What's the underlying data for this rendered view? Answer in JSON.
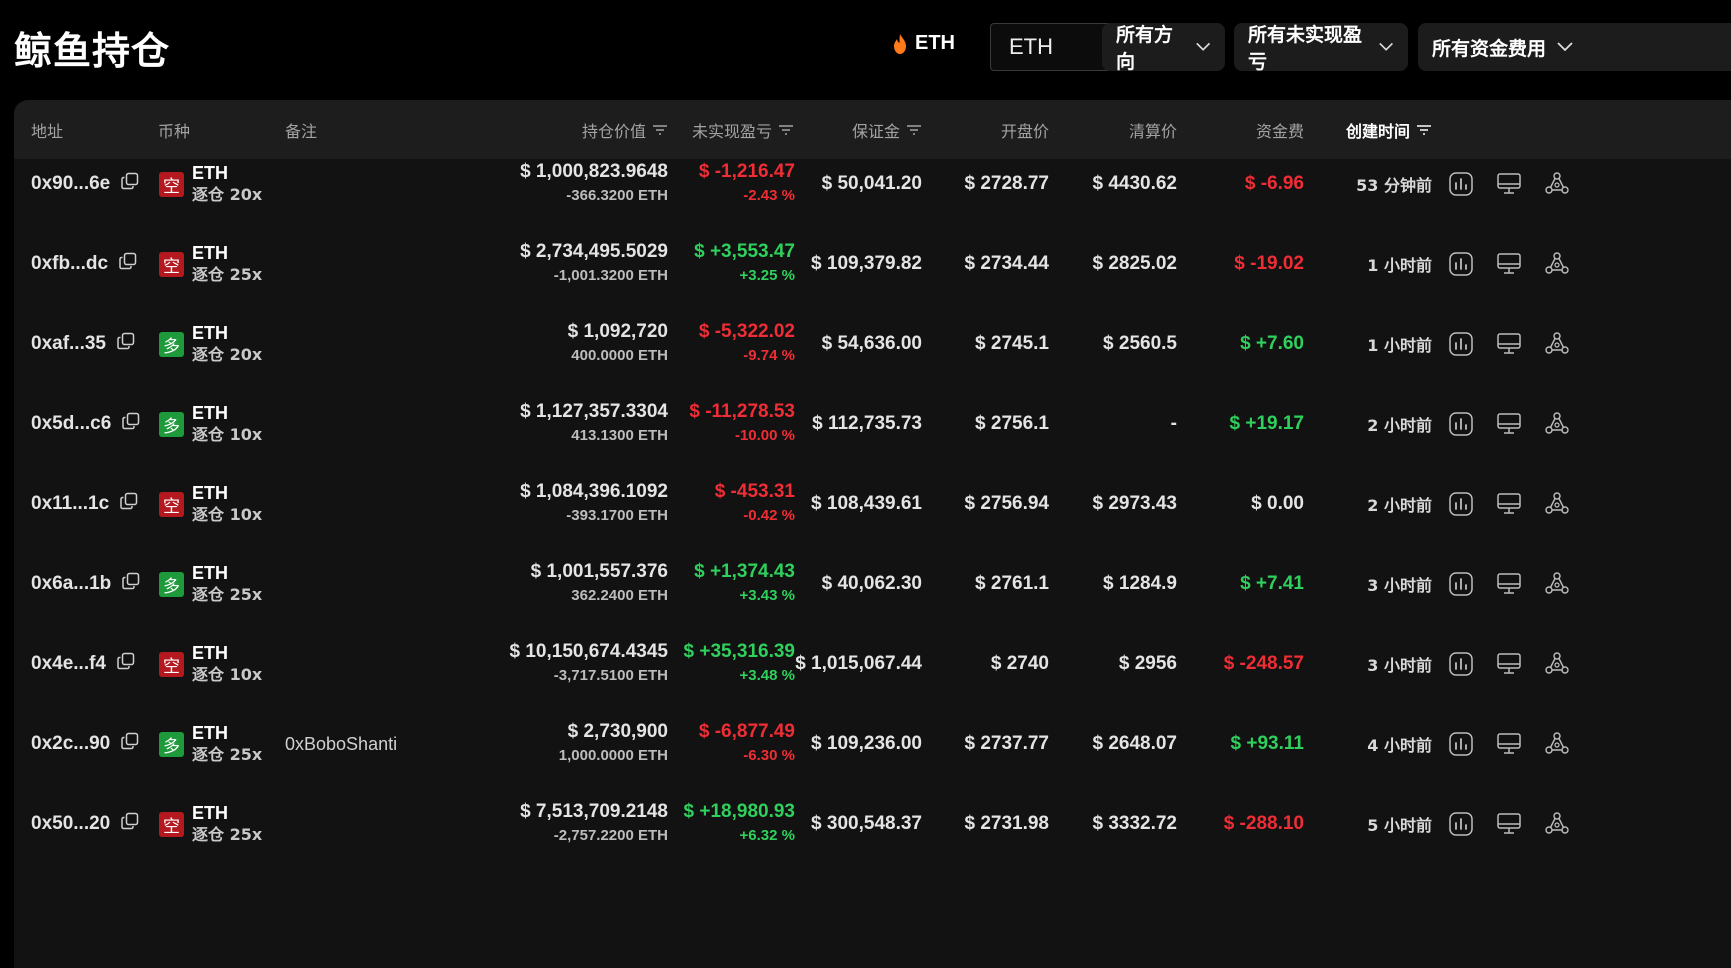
{
  "page": {
    "title": "鲸鱼持仓"
  },
  "filters": {
    "coin_tag": "ETH",
    "coin_select": "ETH",
    "direction": "所有方向",
    "pnl": "所有未实现盈亏",
    "funding": "所有资金费用"
  },
  "table": {
    "headers": {
      "address": "地址",
      "coin": "币种",
      "note": "备注",
      "value": "持仓价值",
      "pnl": "未实现盈亏",
      "margin": "保证金",
      "entry": "开盘价",
      "liq": "清算价",
      "funding": "资金费",
      "created": "创建时间"
    },
    "rows": [
      {
        "address": "0x90...6e",
        "side": "空",
        "side_type": "short",
        "coin": "ETH",
        "leverage": "逐仓 20x",
        "note": "",
        "value": "$ 1,000,823.9648",
        "value_sub": "-366.3200 ETH",
        "pnl": "$ -1,216.47",
        "pnl_pct": "-2.43 %",
        "pnl_sign": "neg",
        "margin": "$ 50,041.20",
        "entry": "$ 2728.77",
        "liq": "$ 4430.62",
        "funding": "$ -6.96",
        "funding_sign": "neg",
        "created": "53 分钟前"
      },
      {
        "address": "0xfb...dc",
        "side": "空",
        "side_type": "short",
        "coin": "ETH",
        "leverage": "逐仓 25x",
        "note": "",
        "value": "$ 2,734,495.5029",
        "value_sub": "-1,001.3200 ETH",
        "pnl": "$ +3,553.47",
        "pnl_pct": "+3.25 %",
        "pnl_sign": "pos",
        "margin": "$ 109,379.82",
        "entry": "$ 2734.44",
        "liq": "$ 2825.02",
        "funding": "$ -19.02",
        "funding_sign": "neg",
        "created": "1 小时前"
      },
      {
        "address": "0xaf...35",
        "side": "多",
        "side_type": "long",
        "coin": "ETH",
        "leverage": "逐仓 20x",
        "note": "",
        "value": "$ 1,092,720",
        "value_sub": "400.0000 ETH",
        "pnl": "$ -5,322.02",
        "pnl_pct": "-9.74 %",
        "pnl_sign": "neg",
        "margin": "$ 54,636.00",
        "entry": "$ 2745.1",
        "liq": "$ 2560.5",
        "funding": "$ +7.60",
        "funding_sign": "pos",
        "created": "1 小时前"
      },
      {
        "address": "0x5d...c6",
        "side": "多",
        "side_type": "long",
        "coin": "ETH",
        "leverage": "逐仓 10x",
        "note": "",
        "value": "$ 1,127,357.3304",
        "value_sub": "413.1300 ETH",
        "pnl": "$ -11,278.53",
        "pnl_pct": "-10.00 %",
        "pnl_sign": "neg",
        "margin": "$ 112,735.73",
        "entry": "$ 2756.1",
        "liq": "-",
        "funding": "$ +19.17",
        "funding_sign": "pos",
        "created": "2 小时前"
      },
      {
        "address": "0x11...1c",
        "side": "空",
        "side_type": "short",
        "coin": "ETH",
        "leverage": "逐仓 10x",
        "note": "",
        "value": "$ 1,084,396.1092",
        "value_sub": "-393.1700 ETH",
        "pnl": "$ -453.31",
        "pnl_pct": "-0.42 %",
        "pnl_sign": "neg",
        "margin": "$ 108,439.61",
        "entry": "$ 2756.94",
        "liq": "$ 2973.43",
        "funding": "$ 0.00",
        "funding_sign": "zero",
        "created": "2 小时前"
      },
      {
        "address": "0x6a...1b",
        "side": "多",
        "side_type": "long",
        "coin": "ETH",
        "leverage": "逐仓 25x",
        "note": "",
        "value": "$ 1,001,557.376",
        "value_sub": "362.2400 ETH",
        "pnl": "$ +1,374.43",
        "pnl_pct": "+3.43 %",
        "pnl_sign": "pos",
        "margin": "$ 40,062.30",
        "entry": "$ 2761.1",
        "liq": "$ 1284.9",
        "funding": "$ +7.41",
        "funding_sign": "pos",
        "created": "3 小时前"
      },
      {
        "address": "0x4e...f4",
        "side": "空",
        "side_type": "short",
        "coin": "ETH",
        "leverage": "逐仓 10x",
        "note": "",
        "value": "$ 10,150,674.4345",
        "value_sub": "-3,717.5100 ETH",
        "pnl": "$ +35,316.39",
        "pnl_pct": "+3.48 %",
        "pnl_sign": "pos",
        "margin": "$ 1,015,067.44",
        "entry": "$ 2740",
        "liq": "$ 2956",
        "funding": "$ -248.57",
        "funding_sign": "neg",
        "created": "3 小时前"
      },
      {
        "address": "0x2c...90",
        "side": "多",
        "side_type": "long",
        "coin": "ETH",
        "leverage": "逐仓 25x",
        "note": "0xBoboShanti",
        "value": "$ 2,730,900",
        "value_sub": "1,000.0000 ETH",
        "pnl": "$ -6,877.49",
        "pnl_pct": "-6.30 %",
        "pnl_sign": "neg",
        "margin": "$ 109,236.00",
        "entry": "$ 2737.77",
        "liq": "$ 2648.07",
        "funding": "$ +93.11",
        "funding_sign": "pos",
        "created": "4 小时前"
      },
      {
        "address": "0x50...20",
        "side": "空",
        "side_type": "short",
        "coin": "ETH",
        "leverage": "逐仓 25x",
        "note": "",
        "value": "$ 7,513,709.2148",
        "value_sub": "-2,757.2200 ETH",
        "pnl": "$ +18,980.93",
        "pnl_pct": "+6.32 %",
        "pnl_sign": "pos",
        "margin": "$ 300,548.37",
        "entry": "$ 2731.98",
        "liq": "$ 3332.72",
        "funding": "$ -288.10",
        "funding_sign": "neg",
        "created": "5 小时前"
      }
    ],
    "row_icons": [
      "chart-icon",
      "monitor-icon",
      "network-icon"
    ]
  },
  "colors": {
    "positive": "#2fd05c",
    "negative": "#ef2d35",
    "short_badge": "#b3191f",
    "long_badge": "#1f9a3a",
    "flame": "#ff7a1a"
  }
}
